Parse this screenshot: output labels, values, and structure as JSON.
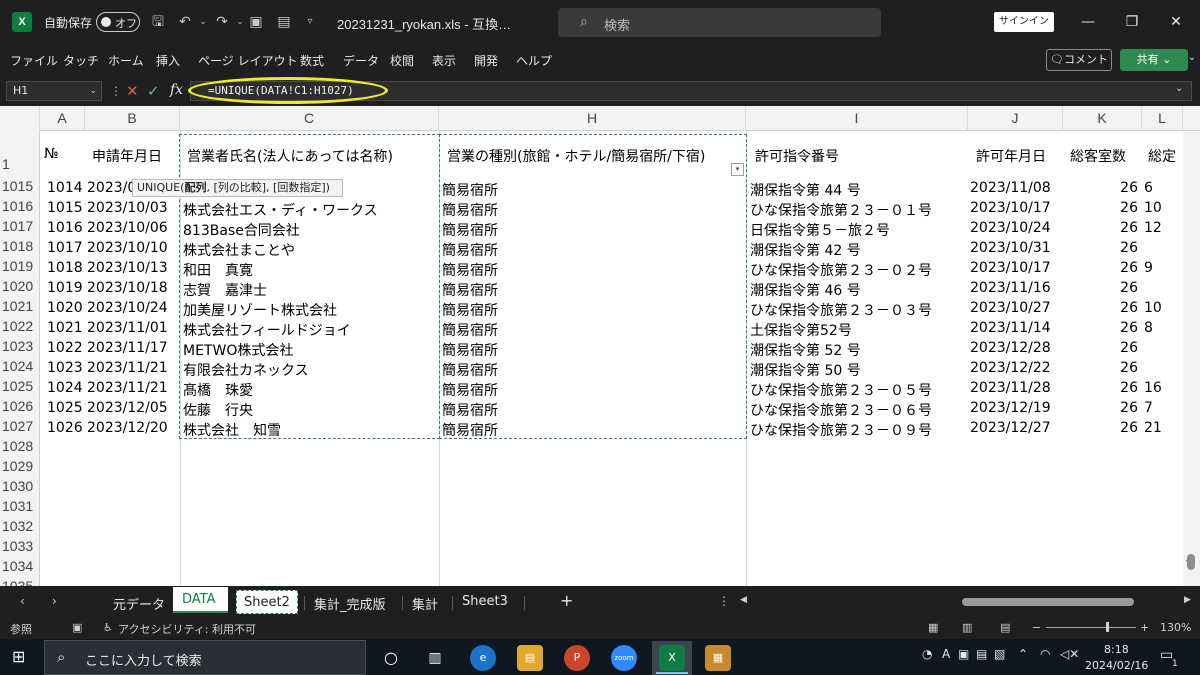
{
  "app": {
    "logo": "X",
    "autosave_label": "自動保存",
    "autosave_state": "オフ",
    "title": "20231231_ryokan.xls  -  互換…",
    "search_placeholder": "検索",
    "signin": "サインイン"
  },
  "ribbon": {
    "tabs": [
      "ファイル",
      "タッチ",
      "ホーム",
      "挿入",
      "ページ レイアウト",
      "数式",
      "データ",
      "校閲",
      "表示",
      "開発",
      "ヘルプ"
    ],
    "comment": "コメント",
    "share": "共有"
  },
  "formula_bar": {
    "name_box": "H1",
    "formula": "=UNIQUE(DATA!C1:H1027)"
  },
  "grid": {
    "columns": [
      "A",
      "B",
      "C",
      "H",
      "I",
      "J",
      "K",
      "L"
    ],
    "header_row_number": "1",
    "headers": [
      "№",
      "申請年月日",
      "営業者氏名(法人にあっては名称)",
      "営業の種別(旅館・ホテル/簡易宿所/下宿)",
      "許可指令番号",
      "許可年月日",
      "総客室数",
      "総定"
    ],
    "tooltip_func": "UNIQUE(",
    "tooltip_bold": "配列",
    "tooltip_rest": ", [列の比較], [回数指定])",
    "rows": [
      {
        "rownum": "1015",
        "no": "1014",
        "date": "2023/0",
        "name": "",
        "type": "簡易宿所",
        "permit": "潮保指令第 44 号",
        "pdate": "2023/11/08",
        "rooms": "26",
        "total": "6"
      },
      {
        "rownum": "1016",
        "no": "1015",
        "date": "2023/10/03",
        "name": "株式会社エス・ディ・ワークス",
        "type": "簡易宿所",
        "permit": "ひな保指令旅第２３－０１号",
        "pdate": "2023/10/17",
        "rooms": "26",
        "total": "10"
      },
      {
        "rownum": "1017",
        "no": "1016",
        "date": "2023/10/06",
        "name": "813Base合同会社",
        "type": "簡易宿所",
        "permit": "日保指令第５－旅２号",
        "pdate": "2023/10/24",
        "rooms": "26",
        "total": "12"
      },
      {
        "rownum": "1018",
        "no": "1017",
        "date": "2023/10/10",
        "name": "株式会社まことや",
        "type": "簡易宿所",
        "permit": "潮保指令第 42 号",
        "pdate": "2023/10/31",
        "rooms": "26",
        "total": ""
      },
      {
        "rownum": "1019",
        "no": "1018",
        "date": "2023/10/13",
        "name": "和田　真寛",
        "type": "簡易宿所",
        "permit": "ひな保指令旅第２３－０２号",
        "pdate": "2023/10/17",
        "rooms": "26",
        "total": "9"
      },
      {
        "rownum": "1020",
        "no": "1019",
        "date": "2023/10/18",
        "name": "志賀　嘉津士",
        "type": "簡易宿所",
        "permit": "潮保指令第 46 号",
        "pdate": "2023/11/16",
        "rooms": "26",
        "total": ""
      },
      {
        "rownum": "1021",
        "no": "1020",
        "date": "2023/10/24",
        "name": "加美屋リゾート株式会社",
        "type": "簡易宿所",
        "permit": "ひな保指令旅第２３－０３号",
        "pdate": "2023/10/27",
        "rooms": "26",
        "total": "10"
      },
      {
        "rownum": "1022",
        "no": "1021",
        "date": "2023/11/01",
        "name": "株式会社フィールドジョイ",
        "type": "簡易宿所",
        "permit": "土保指令第52号",
        "pdate": "2023/11/14",
        "rooms": "26",
        "total": "8"
      },
      {
        "rownum": "1023",
        "no": "1022",
        "date": "2023/11/17",
        "name": "METWO株式会社",
        "type": "簡易宿所",
        "permit": "潮保指令第 52 号",
        "pdate": "2023/12/28",
        "rooms": "26",
        "total": ""
      },
      {
        "rownum": "1024",
        "no": "1023",
        "date": "2023/11/21",
        "name": "有限会社カネックス",
        "type": "簡易宿所",
        "permit": "潮保指令第 50 号",
        "pdate": "2023/12/22",
        "rooms": "26",
        "total": ""
      },
      {
        "rownum": "1025",
        "no": "1024",
        "date": "2023/11/21",
        "name": "髙橋　珠愛",
        "type": "簡易宿所",
        "permit": "ひな保指令旅第２３－０５号",
        "pdate": "2023/11/28",
        "rooms": "26",
        "total": "16"
      },
      {
        "rownum": "1026",
        "no": "1025",
        "date": "2023/12/05",
        "name": "佐藤　行央",
        "type": "簡易宿所",
        "permit": "ひな保指令旅第２３－０６号",
        "pdate": "2023/12/19",
        "rooms": "26",
        "total": "7"
      },
      {
        "rownum": "1027",
        "no": "1026",
        "date": "2023/12/20",
        "name": "株式会社　知雪",
        "type": "簡易宿所",
        "permit": "ひな保指令旅第２３－０９号",
        "pdate": "2023/12/27",
        "rooms": "26",
        "total": "21"
      }
    ],
    "empty_rows": [
      "1028",
      "1029",
      "1030",
      "1031",
      "1032",
      "1033",
      "1034",
      "1035"
    ]
  },
  "sheets": {
    "tabs": [
      "元データ",
      "DATA",
      "Sheet2",
      "集計_完成版",
      "集計",
      "Sheet3"
    ],
    "active": "DATA",
    "add": "+"
  },
  "status": {
    "mode": "参照",
    "accessibility": "アクセシビリティ: 利用不可",
    "zoom": "130%"
  },
  "taskbar": {
    "search_placeholder": "ここに入力して検索",
    "time": "8:18",
    "date": "2024/02/16",
    "notification_count": "1"
  }
}
